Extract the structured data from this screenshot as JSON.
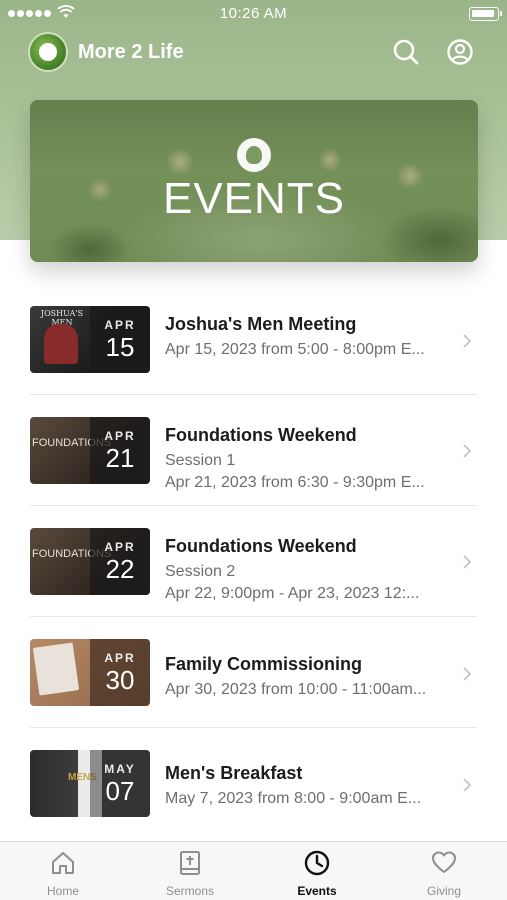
{
  "status_bar": {
    "time": "10:26 AM"
  },
  "app": {
    "title": "More 2 Life"
  },
  "banner": {
    "title": "EVENTS"
  },
  "events": [
    {
      "month": "APR",
      "day": "15",
      "title": "Joshua's Men Meeting",
      "lines": [
        "Apr 15, 2023 from 5:00 - 8:00pm E..."
      ],
      "thumb_text": "JOSHUA'S MEN"
    },
    {
      "month": "APR",
      "day": "21",
      "title": "Foundations Weekend",
      "lines": [
        "Session 1",
        "Apr 21, 2023 from 6:30 - 9:30pm E..."
      ],
      "thumb_text": "FOUNDATIONS"
    },
    {
      "month": "APR",
      "day": "22",
      "title": "Foundations Weekend",
      "lines": [
        "Session 2",
        "Apr 22, 9:00pm - Apr 23, 2023 12:..."
      ],
      "thumb_text": "FOUNDATIONS"
    },
    {
      "month": "APR",
      "day": "30",
      "title": "Family Commissioning",
      "lines": [
        "Apr 30, 2023 from 10:00 - 11:00am..."
      ],
      "thumb_text": ""
    },
    {
      "month": "MAY",
      "day": "07",
      "title": "Men's Breakfast",
      "lines": [
        "May 7, 2023 from 8:00 - 9:00am E..."
      ],
      "thumb_text": "MENS"
    }
  ],
  "tabs": [
    {
      "label": "Home",
      "icon": "home-icon",
      "active": false
    },
    {
      "label": "Sermons",
      "icon": "bible-icon",
      "active": false
    },
    {
      "label": "Events",
      "icon": "clock-icon",
      "active": true
    },
    {
      "label": "Giving",
      "icon": "heart-icon",
      "active": false
    }
  ],
  "colors": {
    "header_green": "#a9c097",
    "accent_text": "#1c1c1c",
    "muted_text": "#6e6e6e"
  }
}
